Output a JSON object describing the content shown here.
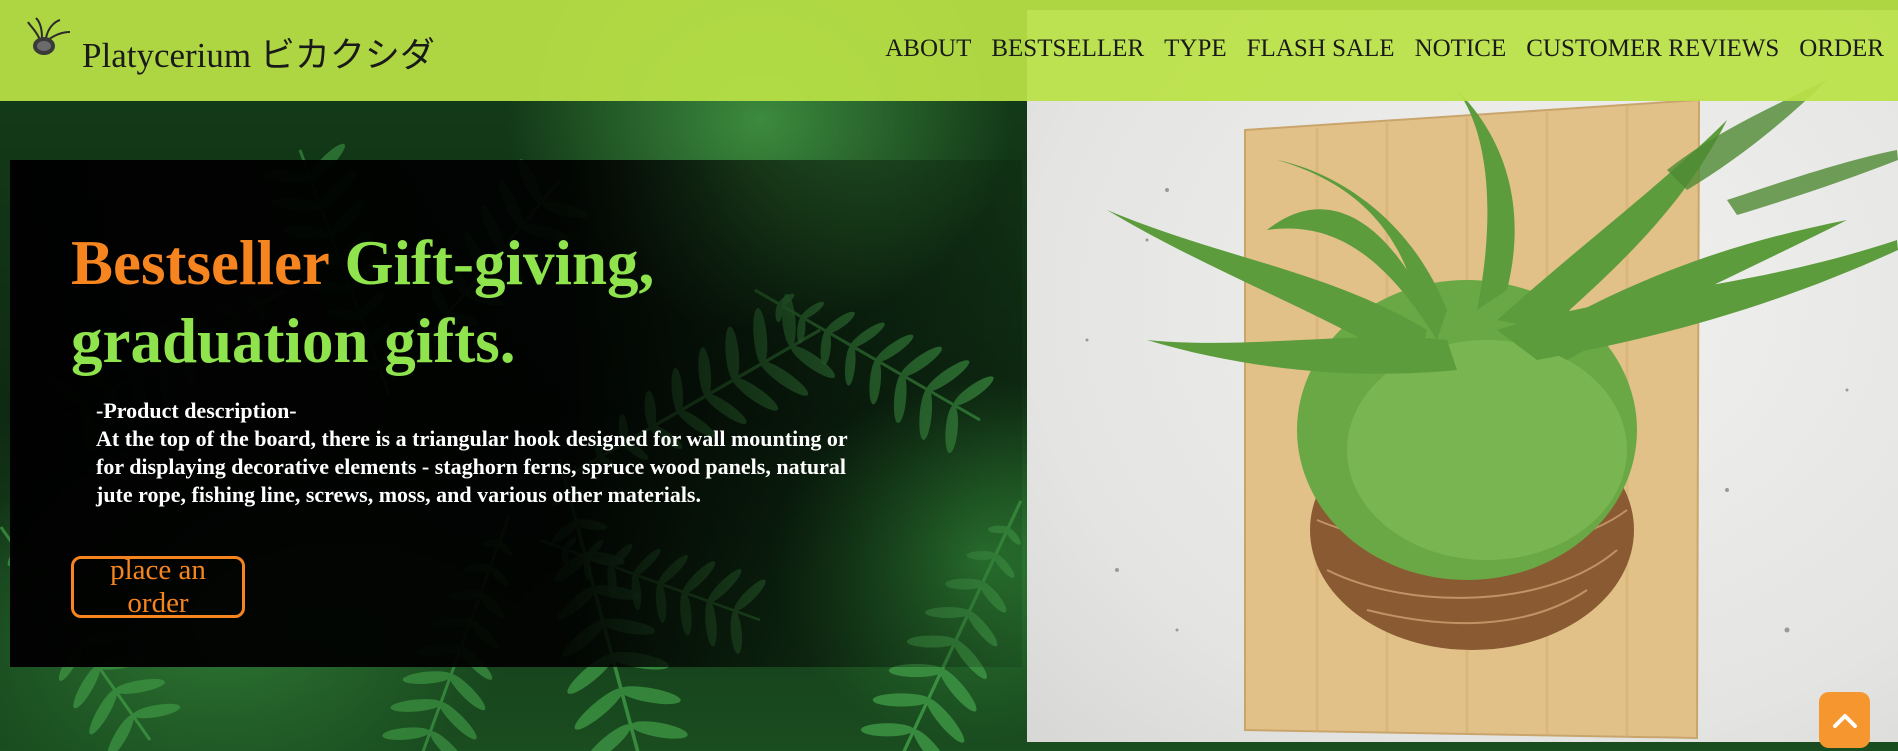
{
  "brand": {
    "name": "Platycerium ビカクシダ",
    "logo_icon": "staghorn-fern-icon"
  },
  "nav": {
    "items": [
      {
        "label": "ABOUT"
      },
      {
        "label": "BESTSELLER"
      },
      {
        "label": "TYPE"
      },
      {
        "label": "FLASH SALE"
      },
      {
        "label": "NOTICE"
      },
      {
        "label": "CUSTOMER REVIEWS"
      },
      {
        "label": "ORDER"
      }
    ]
  },
  "hero": {
    "headline_accent": "Bestseller",
    "headline_rest": " Gift-giving, graduation gifts.",
    "description_title": "-Product description-",
    "description_body": "At the top of the board, there is a triangular hook designed for wall mounting or for displaying decorative elements - staghorn ferns, spruce wood panels, natural jute rope, fishing line, screws, moss, and various other materials.",
    "order_button": "place an order"
  },
  "back_to_top": {
    "icon": "chevron-up-icon"
  },
  "colors": {
    "header_bg": "#bae246",
    "accent_orange": "#f6841f",
    "headline_green": "#8fe34d",
    "nav_text": "#1a1a1a",
    "back_to_top_bg": "#f6962f"
  }
}
